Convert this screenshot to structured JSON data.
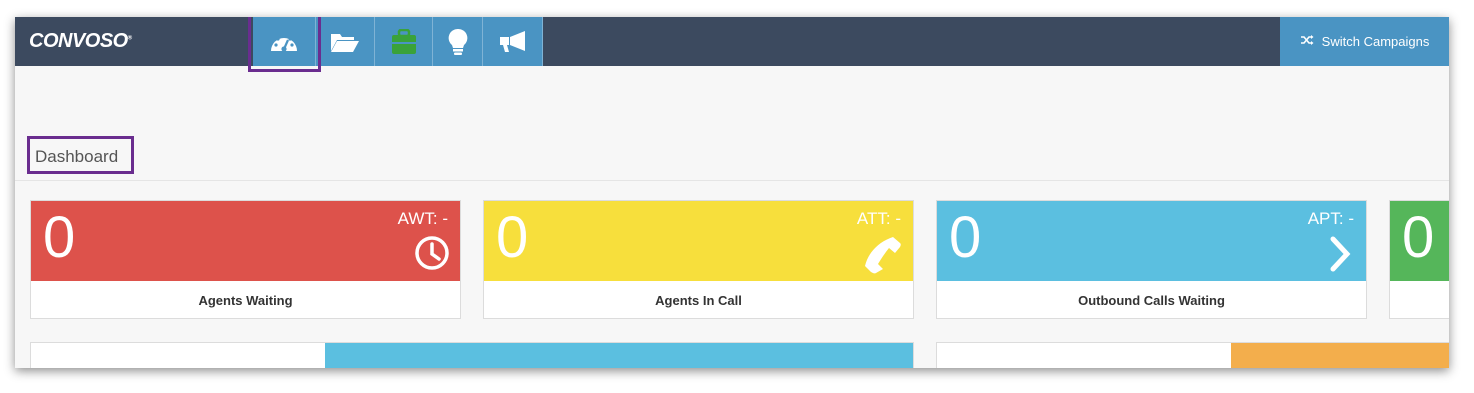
{
  "brand": {
    "logo_text": "CONVOSO",
    "logo_mark": "®"
  },
  "nav": {
    "icons": [
      {
        "name": "dashboard-gauge-icon",
        "selected": true
      },
      {
        "name": "folder-open-icon",
        "selected": false
      },
      {
        "name": "briefcase-icon",
        "selected": false,
        "color": "#3aa23a"
      },
      {
        "name": "lightbulb-icon",
        "selected": false
      },
      {
        "name": "megaphone-icon",
        "selected": false
      }
    ],
    "switch_label": "Switch Campaigns",
    "switch_icon": "shuffle-icon"
  },
  "page": {
    "title": "Dashboard"
  },
  "cards": [
    {
      "value": "0",
      "metric": "AWT: -",
      "icon": "clock-icon",
      "label": "Agents Waiting",
      "color": "#dd524b"
    },
    {
      "value": "0",
      "metric": "ATT: -",
      "icon": "phone-icon",
      "label": "Agents In Call",
      "color": "#f7df3c"
    },
    {
      "value": "0",
      "metric": "APT: -",
      "icon": "chevron-right-icon",
      "label": "Outbound Calls Waiting",
      "color": "#5bbfe0"
    },
    {
      "value": "0",
      "metric": "",
      "icon": "",
      "label": "",
      "color": "#55b65a"
    }
  ],
  "colors": {
    "topbar": "#3c4a5f",
    "nav_active": "#4a94c3",
    "highlight": "#6a2d8f",
    "panel_blue": "#5bbfe0",
    "panel_orange": "#f3ae4c"
  }
}
